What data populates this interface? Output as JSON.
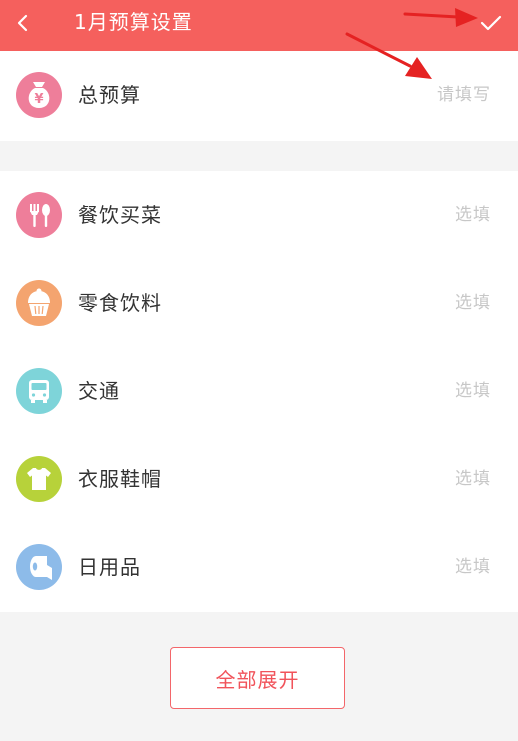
{
  "header": {
    "title": "1月预算设置",
    "back_icon": "chevron-left-icon",
    "confirm_icon": "check-icon",
    "background_color": "#f5605d"
  },
  "total_budget": {
    "label": "总预算",
    "placeholder": "请填写",
    "icon": "money-bag-icon",
    "icon_color": "#ee7e9a"
  },
  "categories": [
    {
      "label": "餐饮买菜",
      "placeholder": "选填",
      "icon": "fork-spoon-icon",
      "icon_color": "#ee7e9a"
    },
    {
      "label": "零食饮料",
      "placeholder": "选填",
      "icon": "cupcake-icon",
      "icon_color": "#f4a46f"
    },
    {
      "label": "交通",
      "placeholder": "选填",
      "icon": "bus-icon",
      "icon_color": "#7ed4d9"
    },
    {
      "label": "衣服鞋帽",
      "placeholder": "选填",
      "icon": "shirt-icon",
      "icon_color": "#b7d23a"
    },
    {
      "label": "日用品",
      "placeholder": "选填",
      "icon": "tissue-roll-icon",
      "icon_color": "#8dbbe9"
    }
  ],
  "expand_button": {
    "label": "全部展开",
    "color": "#f1535a"
  },
  "annotations": {
    "arrow_color": "#e52222"
  }
}
